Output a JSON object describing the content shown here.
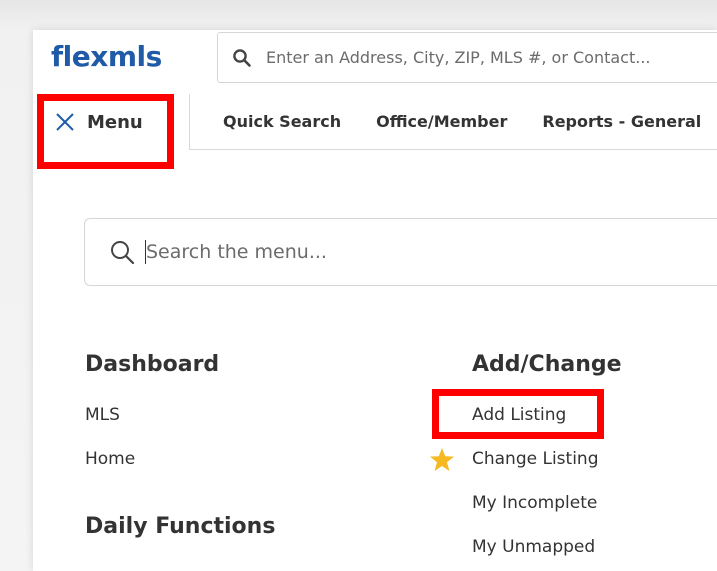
{
  "app": {
    "logo_text": "flexmls"
  },
  "top_search": {
    "placeholder": "Enter an Address, City, ZIP, MLS #, or Contact..."
  },
  "nav": {
    "menu_label": "Menu",
    "tabs": [
      "Quick Search",
      "Office/Member",
      "Reports - General"
    ]
  },
  "menu_search": {
    "placeholder": "Search the menu..."
  },
  "sections": {
    "dashboard": {
      "title": "Dashboard",
      "items": [
        "MLS",
        "Home"
      ]
    },
    "daily_functions": {
      "title": "Daily Functions"
    },
    "add_change": {
      "title": "Add/Change",
      "items": [
        "Add Listing",
        "Change Listing",
        "My Incomplete",
        "My Unmapped"
      ]
    }
  },
  "icons": {
    "search": "search-icon",
    "close": "close-icon",
    "favorite": "star-icon"
  },
  "colors": {
    "brand": "#1f5ba6",
    "highlight": "#ff0000",
    "star": "#f5b921",
    "text": "#333333"
  }
}
